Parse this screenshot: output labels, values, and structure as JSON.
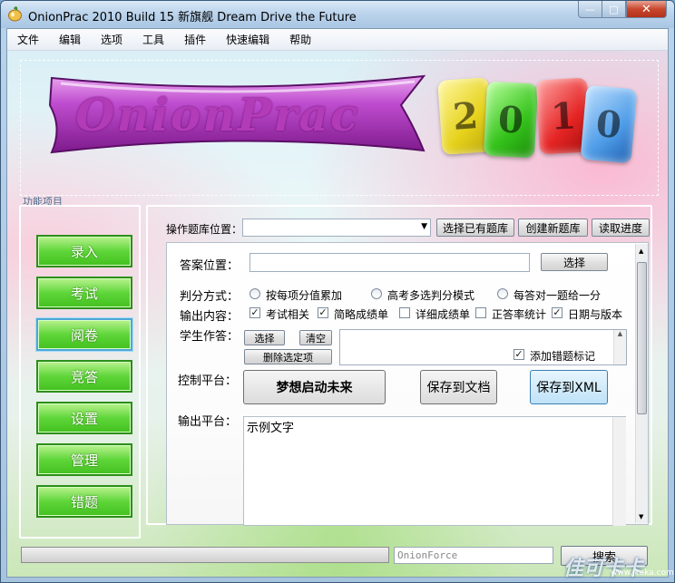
{
  "window": {
    "title": "OnionPrac 2010 Build 15 新旗舰 Dream Drive the Future",
    "min_glyph": "—",
    "max_glyph": "□",
    "close_glyph": "✕"
  },
  "menu": [
    "文件",
    "编辑",
    "选项",
    "工具",
    "插件",
    "快速编辑",
    "帮助"
  ],
  "banner": {
    "logo_text": "OnionPrac",
    "year_digits": [
      "2",
      "0",
      "1",
      "0"
    ],
    "year_colors": [
      "#f2e438",
      "#3fd12b",
      "#f23a3a",
      "#4f9de8"
    ]
  },
  "section_label": "功能项目",
  "nav": [
    "录入",
    "考试",
    "阅卷",
    "竞答",
    "设置",
    "管理",
    "错题"
  ],
  "nav_selected": "阅卷",
  "top": {
    "db_location_label": "操作题库位置：",
    "select_db_button": "选择已有题库",
    "create_db_button": "创建新题库",
    "read_progress_button": "读取进度"
  },
  "form": {
    "answer_location_label": "答案位置：",
    "answer_select_button": "选择",
    "grading_label": "判分方式：",
    "grading_options": [
      {
        "label": "按每项分值累加",
        "selected": false
      },
      {
        "label": "高考多选判分模式",
        "selected": false
      },
      {
        "label": "每答对一题给一分",
        "selected": false
      }
    ],
    "output_content_label": "输出内容：",
    "output_options": [
      {
        "label": "考试相关",
        "checked": true
      },
      {
        "label": "简略成绩单",
        "checked": true
      },
      {
        "label": "详细成绩单",
        "checked": false
      },
      {
        "label": "正答率统计",
        "checked": false
      },
      {
        "label": "日期与版本",
        "checked": true
      }
    ],
    "student_answers_label": "学生作答：",
    "choose_button": "选择",
    "clear_button": "清空",
    "delete_selected_button": "删除选定项",
    "add_wrong_mark_label": "添加错题标记",
    "add_wrong_mark_checked": true,
    "control_label": "控制平台：",
    "start_button": "梦想启动未来",
    "save_doc_button": "保存到文档",
    "save_xml_button": "保存到XML",
    "output_label": "输出平台：",
    "output_text": "示例文字"
  },
  "status": {
    "search_value": "OnionForce",
    "search_button": "搜索"
  },
  "watermark": {
    "text": "佳可卡卡",
    "sub": "www.jkaka.com"
  }
}
